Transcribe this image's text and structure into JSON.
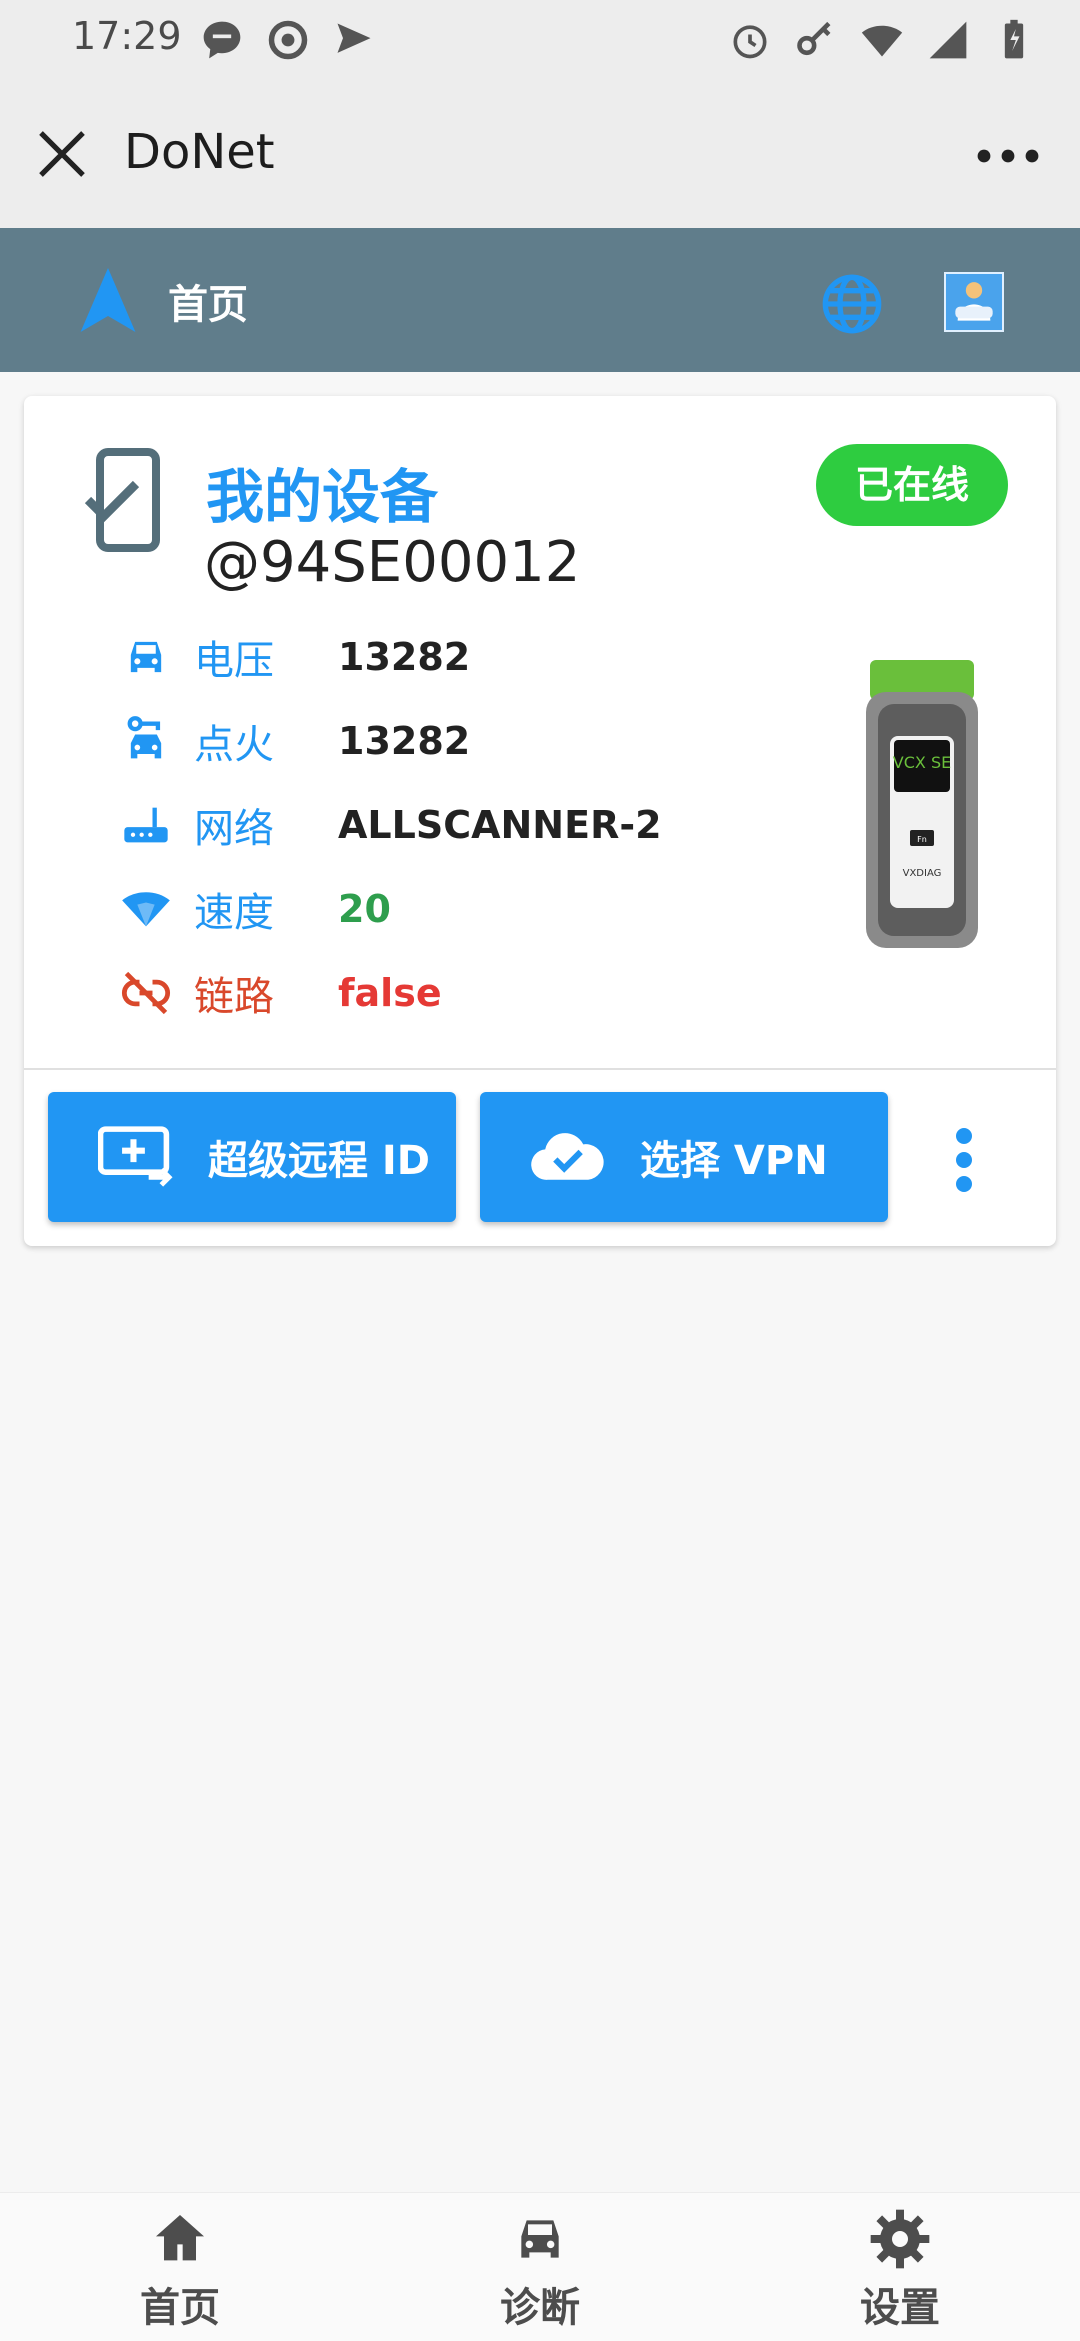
{
  "status_bar": {
    "time": "17:29"
  },
  "title_bar": {
    "title": "DoNet"
  },
  "header": {
    "title": "首页"
  },
  "device_card": {
    "title": "我的设备",
    "device_id": "@94SE00012",
    "status_badge": "已在线",
    "rows": [
      {
        "label": "电压",
        "value": "13282",
        "icon": "car-icon"
      },
      {
        "label": "点火",
        "value": "13282",
        "icon": "car-key-icon"
      },
      {
        "label": "网络",
        "value": "ALLSCANNER-2",
        "icon": "router-icon"
      },
      {
        "label": "速度",
        "value": "20",
        "icon": "wifi-icon"
      },
      {
        "label": "链路",
        "value": "false",
        "icon": "link-off-icon"
      }
    ],
    "product_label": "VCX SE",
    "product_brand": "VXDIAG",
    "product_key": "Fn",
    "buttons": {
      "remote_id": "超级远程 ID",
      "vpn": "选择 VPN"
    }
  },
  "bottom_nav": {
    "home": "首页",
    "diagnose": "诊断",
    "settings": "设置"
  },
  "colors": {
    "header": "#607d8b",
    "accent": "#2196f3",
    "online": "#2ecc40",
    "error": "#e53935",
    "success": "#2e9e4d"
  }
}
